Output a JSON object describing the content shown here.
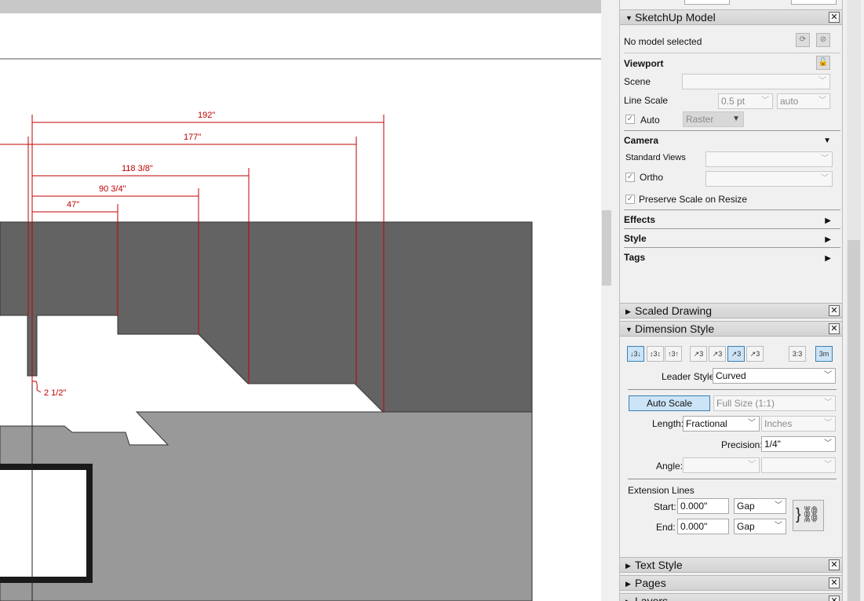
{
  "drawing": {
    "dimensions": [
      "192\"",
      "177\"",
      "118 3/8\"",
      "90 3/4\"",
      "47\"",
      "2 1/2\""
    ]
  },
  "sketchup_model": {
    "title": "SketchUp Model",
    "status": "No model selected",
    "viewport_label": "Viewport",
    "scene_label": "Scene",
    "scene_value": "",
    "line_scale_label": "Line Scale",
    "line_scale_value": "0.5 pt",
    "line_scale_mode": "auto",
    "auto_label": "Auto",
    "render_mode": "Raster",
    "camera_label": "Camera",
    "standard_views_label": "Standard Views",
    "ortho_label": "Ortho",
    "preserve_scale_label": "Preserve Scale on Resize",
    "effects_label": "Effects",
    "style_label": "Style",
    "tags_label": "Tags"
  },
  "scaled_drawing": {
    "title": "Scaled Drawing"
  },
  "dimension_style": {
    "title": "Dimension Style",
    "leader_style_label": "Leader Style:",
    "leader_style_value": "Curved",
    "auto_scale_label": "Auto Scale",
    "scale_value": "Full Size (1:1)",
    "length_label": "Length:",
    "length_value": "Fractional",
    "length_unit": "Inches",
    "precision_label": "Precision:",
    "precision_value": "1/4\"",
    "angle_label": "Angle:",
    "extension_lines_label": "Extension Lines",
    "start_label": "Start:",
    "start_value": "0.000\"",
    "start_mode": "Gap",
    "end_label": "End:",
    "end_value": "0.000\"",
    "end_mode": "Gap"
  },
  "text_style": {
    "title": "Text Style"
  },
  "pages": {
    "title": "Pages"
  },
  "layers": {
    "title": "Layers"
  },
  "colors": {
    "dimension": "#c00000",
    "dark_fill": "#636363",
    "light_fill": "#999999",
    "selected_blue": "#cce4f7"
  }
}
